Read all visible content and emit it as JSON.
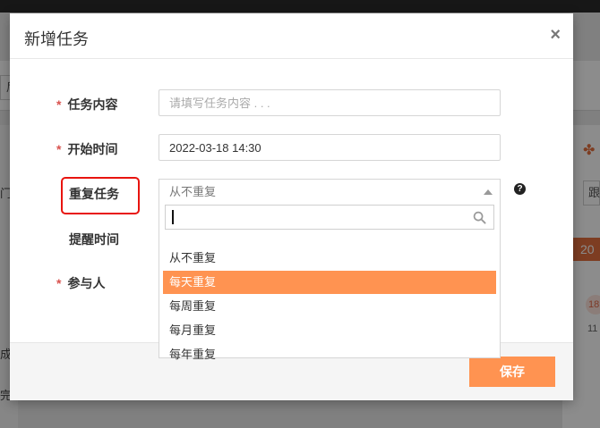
{
  "background": {
    "left_box_text": "后",
    "left_fragment_1": "门:",
    "left_fragment_2": "成",
    "left_fragment_3": "完",
    "right_button_text": "跟",
    "right_orange_text": "20",
    "right_circle_text": "18",
    "right_number_text": "11"
  },
  "modal": {
    "title": "新增任务",
    "close_symbol": "×"
  },
  "form": {
    "required_mark": "*",
    "task_content": {
      "label": "任务内容",
      "placeholder": "请填写任务内容 . . .",
      "value": ""
    },
    "start_time": {
      "label": "开始时间",
      "value": "2022-03-18 14:30"
    },
    "repeat_task": {
      "label": "重复任务",
      "selected": "从不重复",
      "search_value": "",
      "options": [
        "从不重复",
        "每天重复",
        "每周重复",
        "每月重复",
        "每年重复"
      ],
      "highlighted_option": "每天重复"
    },
    "reminder_time": {
      "label": "提醒时间"
    },
    "participants": {
      "label": "参与人"
    },
    "help_symbol": "?"
  },
  "footer": {
    "save_label": "保存"
  },
  "colors": {
    "accent": "#ff9351",
    "required": "#d9534f",
    "highlight_border": "#e8140f"
  }
}
